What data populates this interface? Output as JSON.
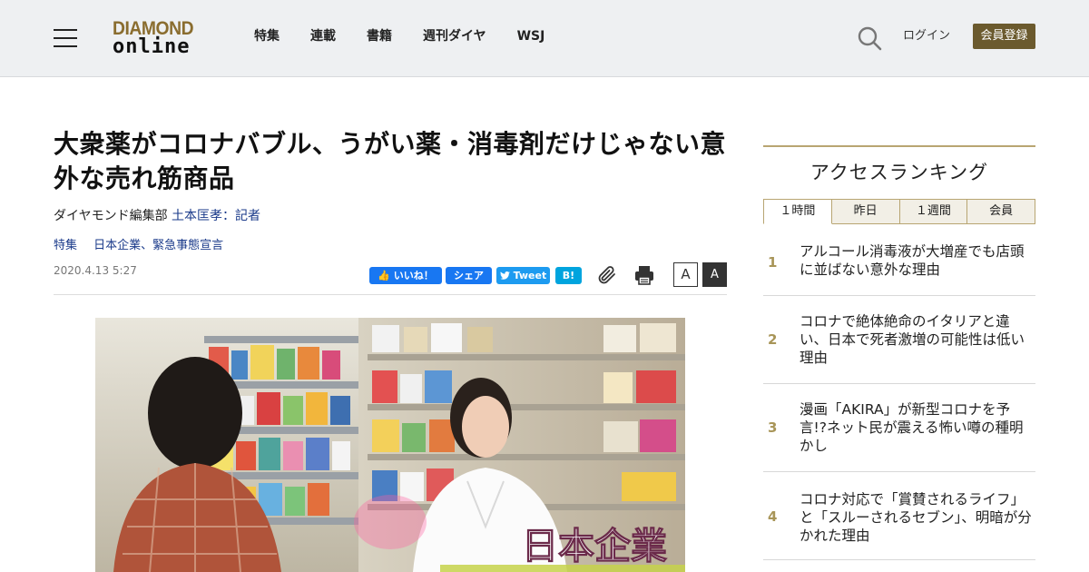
{
  "header": {
    "logo_top": "DIAMOND",
    "logo_bottom": "online",
    "nav": [
      "特集",
      "連載",
      "書籍",
      "週刊ダイヤ",
      "WSJ"
    ],
    "login_label": "ログイン",
    "register_label": "会員登録"
  },
  "article": {
    "title": "大衆薬がコロナバブル、うがい薬・消毒剤だけじゃない意外な売れ筋商品",
    "byline_prefix": "ダイヤモンド編集部 ",
    "author": "土本匡孝：記者",
    "tags": [
      "特集",
      "日本企業、緊急事態宣言"
    ],
    "date": "2020.4.13 5:27",
    "share": {
      "like": "いいね！",
      "share": "シェア",
      "tweet": "Tweet",
      "hatena": "B!"
    },
    "font_small": "A",
    "font_large": "A",
    "hero_overlay_text": "日本企業"
  },
  "ranking": {
    "title": "アクセスランキング",
    "tabs": [
      "１時間",
      "昨日",
      "１週間",
      "会員"
    ],
    "items": [
      {
        "rank": "1",
        "text": "アルコール消毒液が大増産でも店頭に並ばない意外な理由"
      },
      {
        "rank": "2",
        "text": "コロナで絶体絶命のイタリアと違い、日本で死者激増の可能性は低い理由"
      },
      {
        "rank": "3",
        "text": "漫画「AKIRA」が新型コロナを予言!?ネット民が震える怖い噂の種明かし"
      },
      {
        "rank": "4",
        "text": "コロナ対応で「賞賛されるライフ」と「スルーされるセブン」、明暗が分かれた理由"
      }
    ]
  },
  "colors": {
    "accent_gold": "#b8a572",
    "register_bg": "#6b5a2e",
    "link_blue": "#1a3a8a",
    "facebook": "#1877f2",
    "twitter": "#1d9bf0",
    "hatena": "#00a4de"
  }
}
